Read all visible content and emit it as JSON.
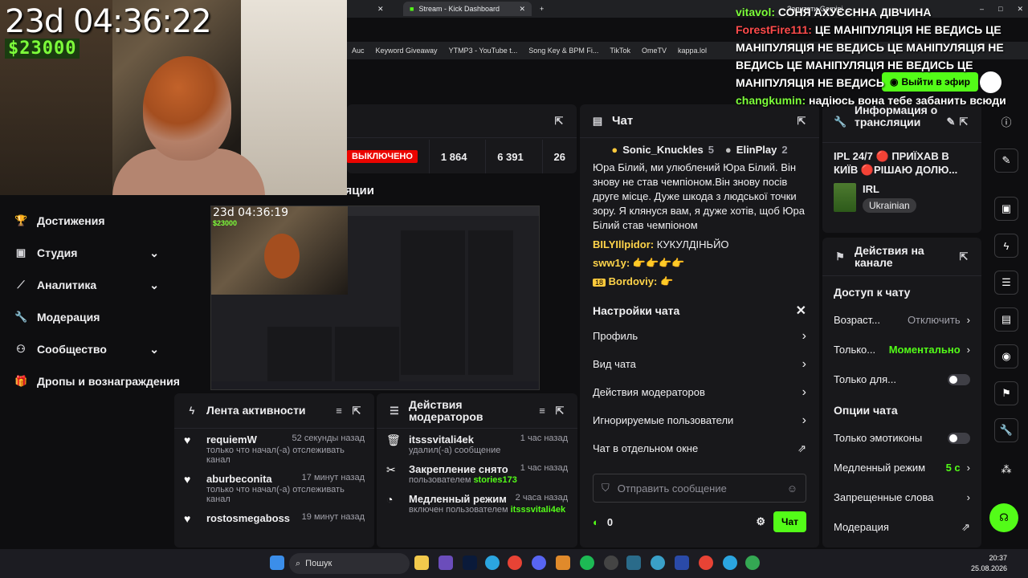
{
  "browser": {
    "tabs": [
      {
        "label": "Stream - Kick Dashboard",
        "active": true
      },
      {
        "label": "Запитати Gemini",
        "active": false
      }
    ],
    "bookmarks": [
      "Auc",
      "Keyword Giveaway",
      "YTMP3 - YouTube t...",
      "Song Key & BPM Fi...",
      "TikTok",
      "OmeTV",
      "kappa.lol"
    ]
  },
  "webcam": {
    "timer": "23d 04:36:22",
    "money": "$23000"
  },
  "overlay_chat": [
    {
      "user": "vitavol:",
      "user_color": "#7dff3a",
      "text": "СОНЯ АХУЄЄННА ДІВЧИНА"
    },
    {
      "user": "ForestFire111:",
      "user_color": "#ff4b4b",
      "text": "ЦЕ МАНІПУЛЯЦІЯ НЕ ВЕДИСЬ ЦЕ МАНІПУЛЯЦІЯ НЕ ВЕДИСЬ ЦЕ МАНІПУЛЯЦІЯ НЕ ВЕДИСЬ ЦЕ МАНІПУЛЯЦІЯ НЕ ВЕДИСЬ ЦЕ МАНІПУЛЯЦІЯ НЕ ВЕДИСЬ"
    },
    {
      "user": "changkumin:",
      "user_color": "#7dff3a",
      "text": "надіюсь вона тебе забанить всюди"
    }
  ],
  "header": {
    "go_live": "Выйти в эфир"
  },
  "left_nav": [
    {
      "label": "Достижения",
      "icon": "trophy-icon",
      "chevron": false
    },
    {
      "label": "Студия",
      "icon": "studio-icon",
      "chevron": true
    },
    {
      "label": "Аналитика",
      "icon": "analytics-icon",
      "chevron": true
    },
    {
      "label": "Модерация",
      "icon": "wrench-icon",
      "chevron": false
    },
    {
      "label": "Сообщество",
      "icon": "community-icon",
      "chevron": true
    },
    {
      "label": "Дропы и вознаграждения",
      "icon": "gift-icon",
      "chevron": false
    }
  ],
  "stats": {
    "status": "ВЫКЛЮЧЕНО",
    "values": [
      "1 864",
      "6 391",
      "26"
    ]
  },
  "preview": {
    "title_fragment": "ляции",
    "timer": "23d 04:36:19",
    "money": "$23000"
  },
  "chat": {
    "title": "Чат",
    "top_badges": [
      {
        "name": "Sonic_Knuckles",
        "count": "5"
      },
      {
        "name": "ElinPlay",
        "count": "2"
      }
    ],
    "message_text": "Юра Білий, ми улюблений Юра Білий. Він знову не став чемпіоном.Він знову посів друге місце. Дуже шкода з людської точки зору. Я клянуся вам, я дуже хотів, щоб Юра Білий став чемпіоном",
    "messages": [
      {
        "user": "BILYIllpidor:",
        "text": "КУКУЛДІНЬЙО"
      },
      {
        "user": "sww1y:",
        "text": "👉👉👉👉"
      },
      {
        "user": "Bordoviy:",
        "text": "👉",
        "badge": "18"
      }
    ],
    "settings_title": "Настройки чата",
    "settings_items": [
      "Профиль",
      "Вид чата",
      "Действия модераторов",
      "Игнорируемые пользователи",
      "Чат в отдельном окне"
    ],
    "input_placeholder": "Отправить сообщение",
    "points": "0",
    "send_label": "Чат"
  },
  "info": {
    "title": "Информация о трансляции",
    "stream_title": "IPL 24/7 🔴 ПРИЇХАВ В КИЇВ 🔴РІШАЮ ДОЛЮ...",
    "category": "IRL",
    "language": "Ukrainian"
  },
  "actions": {
    "title": "Действия на канале",
    "access_title": "Доступ к чату",
    "rows": [
      {
        "label": "Возраст...",
        "value": "Отключить",
        "value_green": false,
        "type": "arrow"
      },
      {
        "label": "Только...",
        "value": "Моментально",
        "value_green": true,
        "type": "arrow"
      },
      {
        "label": "Только для...",
        "value": "",
        "value_green": false,
        "type": "toggle"
      }
    ],
    "options_title": "Опции чата",
    "options": [
      {
        "label": "Только эмотиконы",
        "value": "",
        "type": "toggle"
      },
      {
        "label": "Медленный режим",
        "value": "5 с",
        "type": "arrow"
      },
      {
        "label": "Запрещенные слова",
        "value": "",
        "type": "arrow"
      },
      {
        "label": "Модерация",
        "value": "",
        "type": "external"
      }
    ]
  },
  "activity": {
    "title": "Лента активности",
    "items": [
      {
        "name": "requiemW",
        "time": "52 секунды назад",
        "text": "только что начал(-а) отслеживать канал"
      },
      {
        "name": "aburbeconita",
        "time": "17 минут назад",
        "text": "только что начал(-а) отслеживать канал"
      },
      {
        "name": "rostosmegaboss",
        "time": "19 минут назад",
        "text": ""
      }
    ]
  },
  "mod_actions": {
    "title": "Действия модераторов",
    "items": [
      {
        "name": "itsssvitali4ek",
        "time": "1 час назад",
        "text": "удалил(-а) сообщение",
        "highlight": ""
      },
      {
        "name": "Закрепление снято",
        "time": "1 час назад",
        "text": "пользователем ",
        "highlight": "stories173"
      },
      {
        "name": "Медленный режим",
        "time": "2 часа назад",
        "text": "включен пользователем ",
        "highlight": "itsssvitali4ek"
      }
    ]
  },
  "taskbar": {
    "search": "Пошук",
    "time": "20:37",
    "date": "25.08.2026"
  },
  "colors": {
    "accent": "#53fc18",
    "panel": "#18181b",
    "bg": "#0e0e10"
  }
}
